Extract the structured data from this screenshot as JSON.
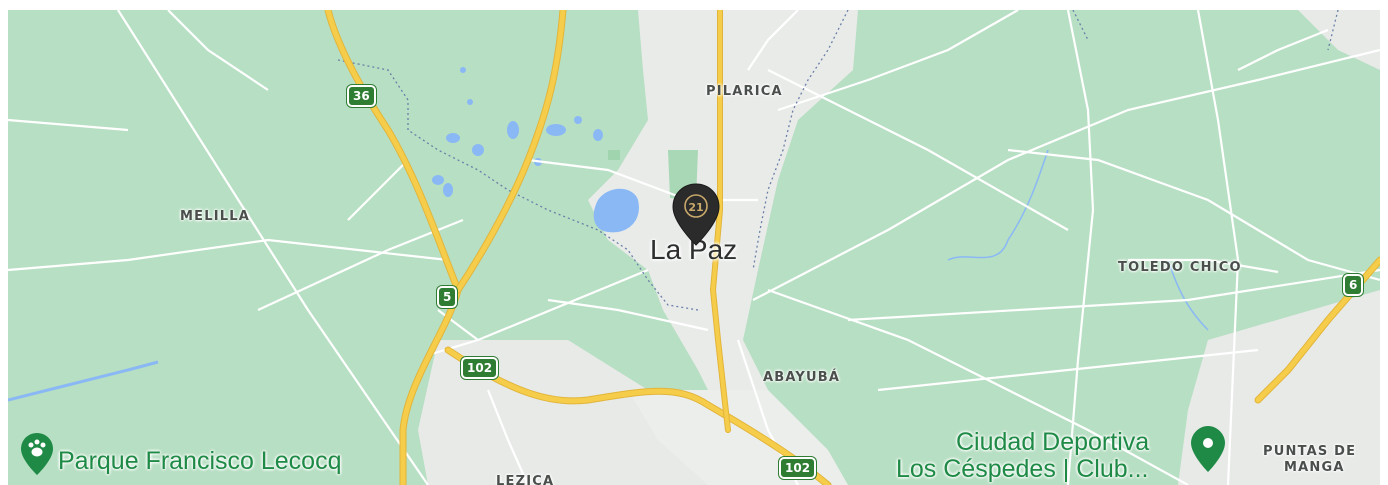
{
  "map": {
    "localities": {
      "pilarica": "PILARICA",
      "melilla": "MELILLA",
      "toledo_chico": "TOLEDO CHICO",
      "abayuba": "ABAYUBÁ",
      "lezica": "LEZICA",
      "puntas_de_manga_line1": "PUNTAS DE",
      "puntas_de_manga_line2": "MANGA"
    },
    "city": "La Paz",
    "route_shields": {
      "r36": "36",
      "r5": "5",
      "r102_west": "102",
      "r102_south": "102",
      "r6": "6"
    },
    "pois": {
      "parque": "Parque Francisco Lecocq",
      "ciudad_line1": "Ciudad Deportiva",
      "ciudad_line2": "Los Céspedes | Club..."
    },
    "marker": {
      "logo_text": "21",
      "icon": "century21-map-pin-icon",
      "color": "#2b2b2b",
      "accent": "#c9a96b"
    },
    "colors": {
      "land": "#b7dfc3",
      "urban": "#e8eae8",
      "highway": "#f6cd4a",
      "road": "#ffffff",
      "water": "#8ab8f5",
      "poi_green": "#1e8a46",
      "shield": "#2e7d32"
    }
  }
}
